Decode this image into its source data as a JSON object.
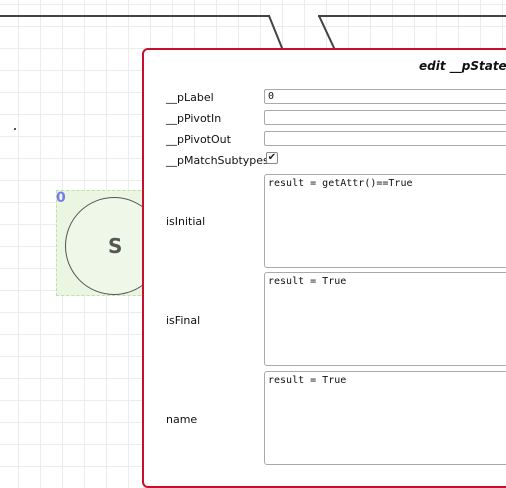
{
  "canvas": {
    "node": {
      "index": "0",
      "label": "S"
    }
  },
  "dialog": {
    "title": "edit __pState #",
    "fields": {
      "pLabel": {
        "label": "__pLabel",
        "value": "0"
      },
      "pPivotIn": {
        "label": "__pPivotIn",
        "value": ""
      },
      "pPivotOut": {
        "label": "__pPivotOut",
        "value": ""
      },
      "pMatchSubtypes": {
        "label": "__pMatchSubtypes",
        "checked": true,
        "check_glyph": "✔"
      },
      "isInitial": {
        "label": "isInitial",
        "value": "result = getAttr()==True"
      },
      "isFinal": {
        "label": "isFinal",
        "value": "result = True"
      },
      "name": {
        "label": "name",
        "value": "result = True"
      }
    }
  },
  "colors": {
    "dialog_border": "#c8102e",
    "node_fill": "#eaf6e2",
    "node_index": "#7b7be6"
  }
}
